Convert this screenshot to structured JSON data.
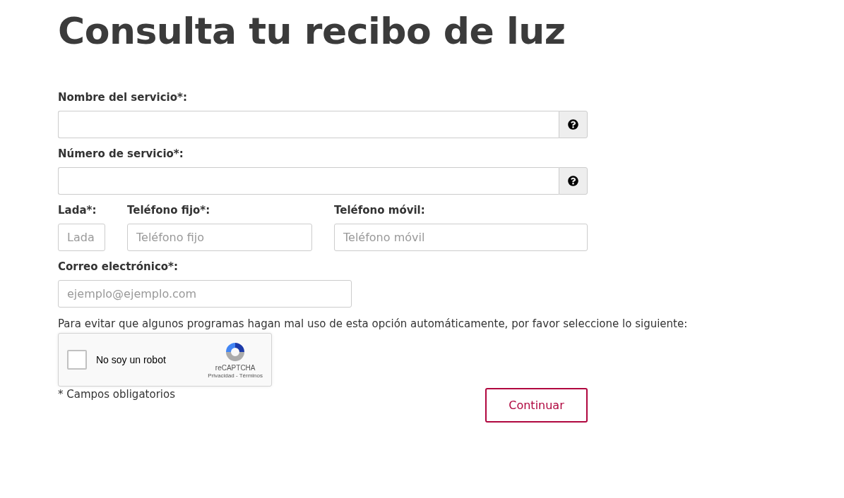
{
  "title": "Consulta tu recibo de luz",
  "rows": [
    {
      "fields": [
        {
          "label": "Nombre del servicio*:",
          "kind": "help"
        }
      ]
    },
    {
      "fields": [
        {
          "label": "Número de servicio*:",
          "kind": "help"
        }
      ]
    },
    {
      "fields": [
        {
          "label": "Lada*:",
          "kind": "text",
          "placeholder": "Lada"
        },
        {
          "label": "Teléfono fijo*:",
          "kind": "text",
          "placeholder": "Teléfono fijo"
        },
        {
          "label": "Teléfono móvil:",
          "kind": "text",
          "placeholder": "Teléfono móvil"
        }
      ]
    },
    {
      "fields": [
        {
          "label": "Correo electrónico*:",
          "kind": "text",
          "placeholder": "ejemplo@ejemplo.com"
        }
      ]
    }
  ],
  "captcha_prompt": "Para evitar que algunos programas hagan mal uso de esta opción automáticamente, por favor seleccione lo siguiente:",
  "captcha": {
    "label": "No soy un robot",
    "checked": false,
    "brand": "reCAPTCHA",
    "links": "Privacidad - Términos"
  },
  "required_note": "* Campos obligatorios",
  "submit": "Continuar"
}
